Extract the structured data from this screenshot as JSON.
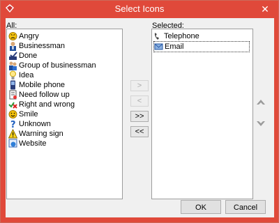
{
  "window": {
    "title": "Select Icons",
    "close_label": "✕"
  },
  "all_list": {
    "label": "All:",
    "items": [
      {
        "label": "Angry",
        "icon": "angry-face-icon"
      },
      {
        "label": "Businessman",
        "icon": "businessman-icon"
      },
      {
        "label": "Done",
        "icon": "done-check-icon"
      },
      {
        "label": "Group of businessman",
        "icon": "group-icon"
      },
      {
        "label": "Idea",
        "icon": "lightbulb-icon"
      },
      {
        "label": "Mobile phone",
        "icon": "mobile-phone-icon"
      },
      {
        "label": "Need follow up",
        "icon": "follow-up-icon"
      },
      {
        "label": "Right and wrong",
        "icon": "right-wrong-icon"
      },
      {
        "label": "Smile",
        "icon": "smile-face-icon"
      },
      {
        "label": "Unknown",
        "icon": "question-mark-icon"
      },
      {
        "label": "Warning sign",
        "icon": "warning-icon"
      },
      {
        "label": "Website",
        "icon": "website-icon"
      }
    ]
  },
  "selected_list": {
    "label": "Selected:",
    "items": [
      {
        "label": "Telephone",
        "icon": "telephone-icon"
      },
      {
        "label": "Email",
        "icon": "email-icon"
      }
    ]
  },
  "transfer_buttons": {
    "add": ">",
    "remove": "<",
    "add_all": ">>",
    "remove_all": "<<"
  },
  "footer": {
    "ok": "OK",
    "cancel": "Cancel"
  },
  "colors": {
    "titlebar": "#e0493a",
    "dialog_bg": "#f0f0f0",
    "arrow_gray": "#9a9a9a"
  }
}
